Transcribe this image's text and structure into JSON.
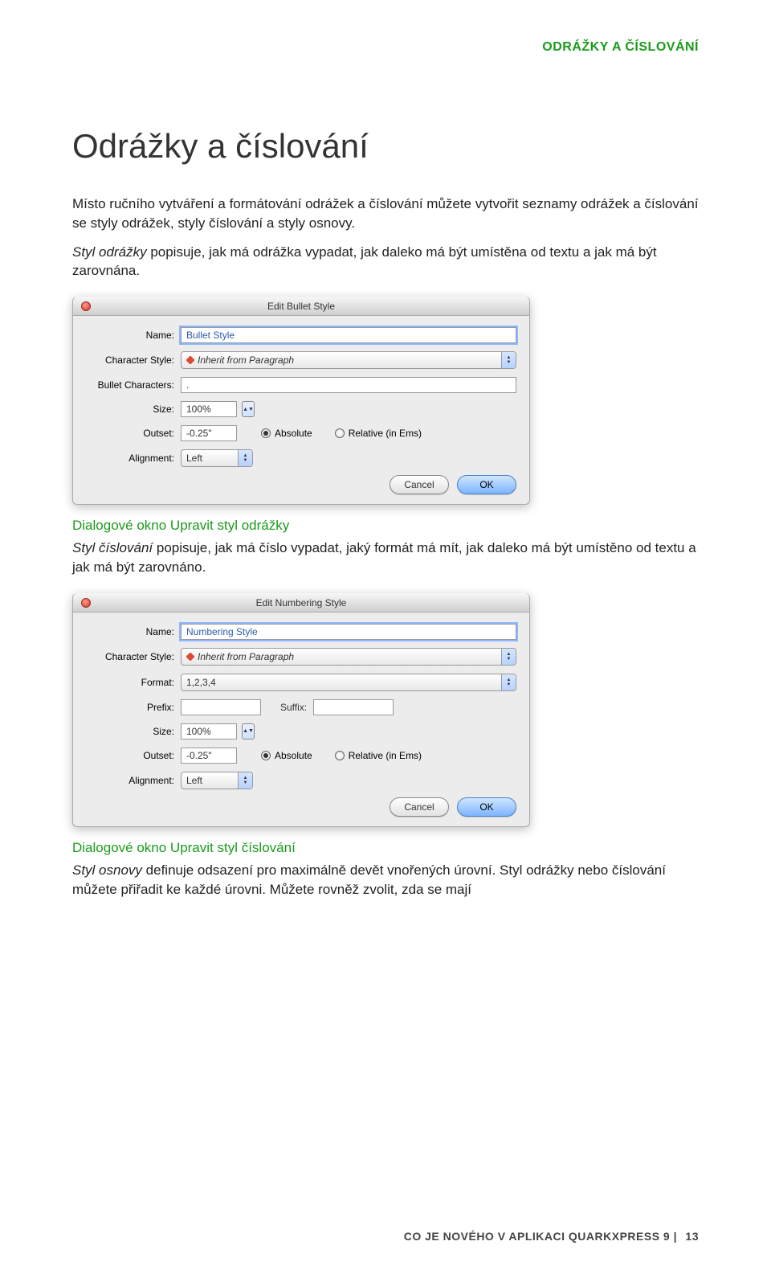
{
  "header_small": "ODRÁŽKY A ČÍSLOVÁNÍ",
  "main_title": "Odrážky a číslování",
  "para1_a": "Místo ručního vytváření a formátování odrážek a číslování můžete vytvořit seznamy odrážek a číslování se styly odrážek, styly číslování a styly osnovy.",
  "para2_em": "Styl odrážky",
  "para2_rest": " popisuje, jak má odrážka vypadat, jak daleko má být umístěna od textu a jak má být zarovnána.",
  "caption1": "Dialogové okno Upravit styl odrážky",
  "para3_em": "Styl číslování",
  "para3_rest": " popisuje, jak má číslo vypadat, jaký formát má mít, jak daleko má být umístěno od textu a jak má být zarovnáno.",
  "caption2": "Dialogové okno Upravit styl číslování",
  "para4_em": "Styl osnovy",
  "para4_rest": " definuje odsazení pro maximálně devět vnořených úrovní. Styl odrážky nebo číslování můžete přiřadit ke každé úrovni. Můžete rovněž zvolit, zda se mají",
  "footer_text": "CO JE NOVÉHO V APLIKACI QUARKXPRESS 9",
  "footer_sep": " | ",
  "footer_page": "13",
  "dialog1": {
    "title": "Edit Bullet Style",
    "labels": {
      "name": "Name:",
      "charstyle": "Character Style:",
      "bullets": "Bullet Characters:",
      "size": "Size:",
      "outset": "Outset:",
      "align": "Alignment:"
    },
    "name_value": "Bullet Style",
    "charstyle_value": "Inherit from Paragraph",
    "bullets_value": ".",
    "size_value": "100%",
    "outset_value": "-0.25\"",
    "radio_abs": "Absolute",
    "radio_rel": "Relative (in Ems)",
    "align_value": "Left",
    "cancel": "Cancel",
    "ok": "OK"
  },
  "dialog2": {
    "title": "Edit Numbering Style",
    "labels": {
      "name": "Name:",
      "charstyle": "Character Style:",
      "format": "Format:",
      "prefix": "Prefix:",
      "suffix": "Suffix:",
      "size": "Size:",
      "outset": "Outset:",
      "align": "Alignment:"
    },
    "name_value": "Numbering Style",
    "charstyle_value": "Inherit from Paragraph",
    "format_value": "1,2,3,4",
    "prefix_value": "",
    "suffix_value": "",
    "size_value": "100%",
    "outset_value": "-0.25\"",
    "radio_abs": "Absolute",
    "radio_rel": "Relative (in Ems)",
    "align_value": "Left",
    "cancel": "Cancel",
    "ok": "OK"
  }
}
